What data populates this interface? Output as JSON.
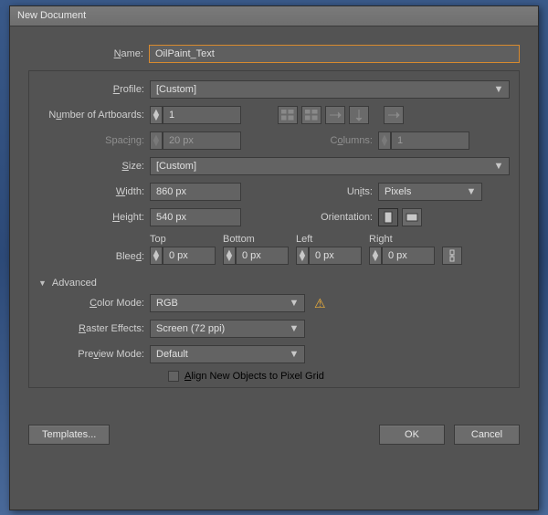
{
  "window": {
    "title": "New Document"
  },
  "name": {
    "label": "Name:",
    "value": "OilPaint_Text"
  },
  "profile": {
    "label": "Profile:",
    "value": "[Custom]"
  },
  "artboards": {
    "label": "Number of Artboards:",
    "value": "1"
  },
  "spacing": {
    "label": "Spacing:",
    "value": "20 px"
  },
  "columns": {
    "label": "Columns:",
    "value": "1"
  },
  "size": {
    "label": "Size:",
    "value": "[Custom]"
  },
  "width": {
    "label": "Width:",
    "value": "860 px"
  },
  "height": {
    "label": "Height:",
    "value": "540 px"
  },
  "units": {
    "label": "Units:",
    "value": "Pixels"
  },
  "orientation": {
    "label": "Orientation:"
  },
  "bleed": {
    "label": "Bleed:",
    "top_label": "Top",
    "top": "0 px",
    "bottom_label": "Bottom",
    "bottom": "0 px",
    "left_label": "Left",
    "left": "0 px",
    "right_label": "Right",
    "right": "0 px"
  },
  "advanced": {
    "label": "Advanced"
  },
  "color_mode": {
    "label": "Color Mode:",
    "value": "RGB"
  },
  "raster": {
    "label": "Raster Effects:",
    "value": "Screen (72 ppi)"
  },
  "preview": {
    "label": "Preview Mode:",
    "value": "Default"
  },
  "align_grid": {
    "label": "Align New Objects to Pixel Grid"
  },
  "buttons": {
    "templates": "Templates...",
    "ok": "OK",
    "cancel": "Cancel"
  }
}
